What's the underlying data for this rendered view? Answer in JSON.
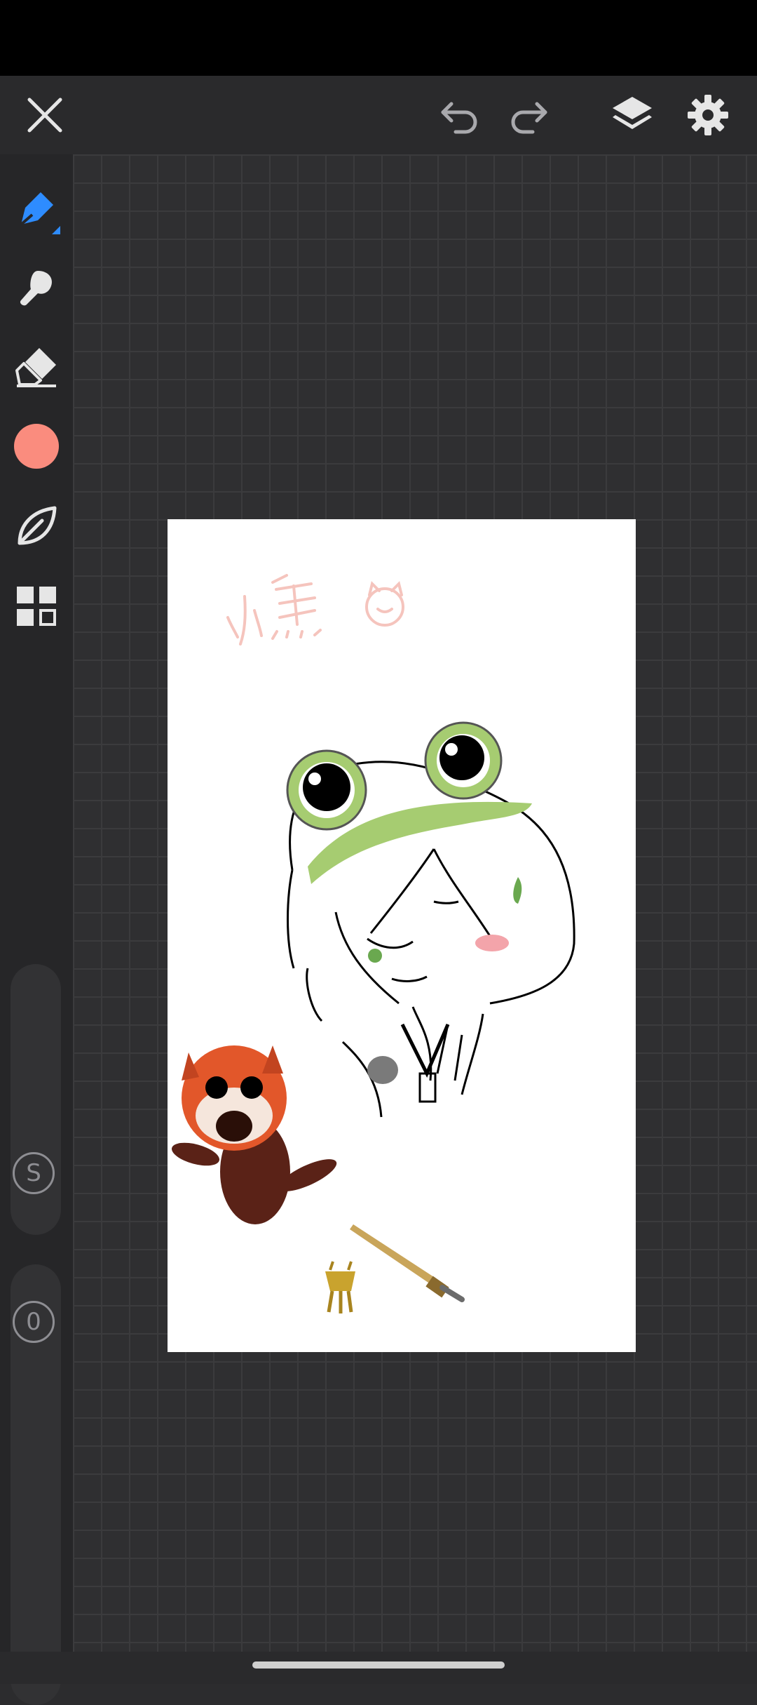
{
  "toolbar": {
    "close_icon": "close-icon",
    "undo_icon": "undo-icon",
    "redo_icon": "redo-icon",
    "layers_icon": "layers-icon",
    "settings_icon": "gear-icon"
  },
  "sidebar": {
    "tools": [
      {
        "name": "pen",
        "icon": "pen-icon",
        "active": true
      },
      {
        "name": "smudge",
        "icon": "smudge-icon",
        "active": false
      },
      {
        "name": "eraser",
        "icon": "eraser-icon",
        "active": false
      },
      {
        "name": "color",
        "icon": "color-swatch",
        "active": false
      },
      {
        "name": "brush-library",
        "icon": "leaf-icon",
        "active": false
      },
      {
        "name": "more",
        "icon": "grid-icon",
        "active": false
      }
    ],
    "current_color": "#fa8c7e",
    "accent_color": "#2e8cff",
    "size_label": "S",
    "opacity_label": "0"
  },
  "canvas": {
    "background": "#ffffff",
    "sticker_signature": "小熊"
  }
}
